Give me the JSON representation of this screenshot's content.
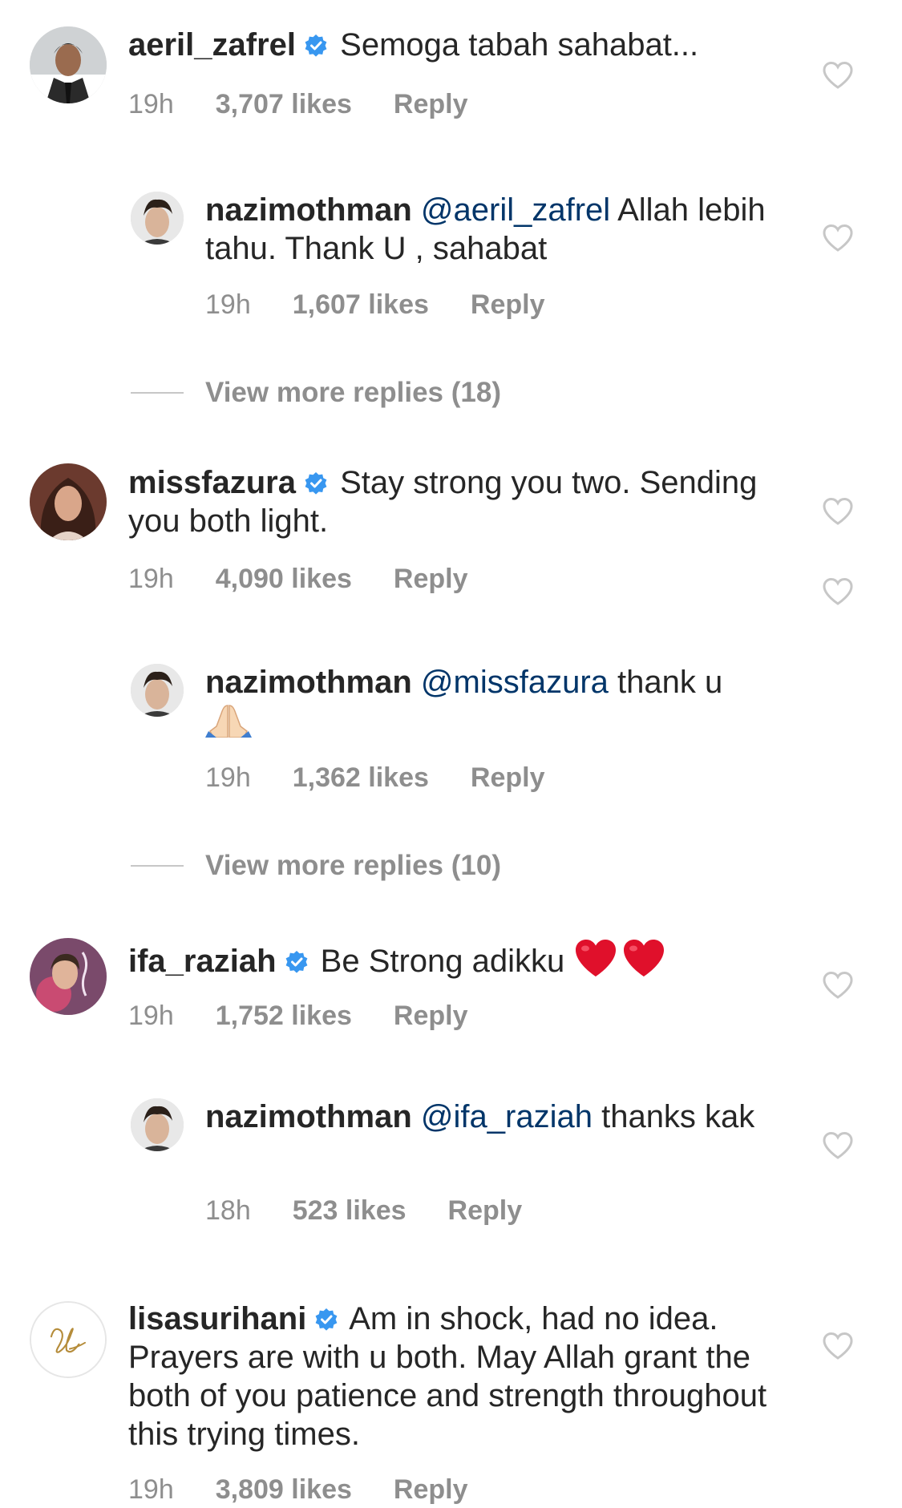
{
  "comments": [
    {
      "username": "aeril_zafrel",
      "verified": true,
      "text": "Semoga tabah sahabat...",
      "time": "19h",
      "likes": "3,707 likes",
      "reply_label": "Reply",
      "reply": {
        "username": "nazimothman",
        "mention": "@aeril_zafrel",
        "text": " Allah lebih tahu. Thank U , sahabat",
        "time": "19h",
        "likes": "1,607 likes",
        "reply_label": "Reply"
      },
      "view_more": "View more replies (18)"
    },
    {
      "username": "missfazura",
      "verified": true,
      "text": "Stay strong you two. Sending you both light.",
      "time": "19h",
      "likes": "4,090 likes",
      "reply_label": "Reply",
      "reply": {
        "username": "nazimothman",
        "mention": "@missfazura",
        "text": " thank u",
        "emoji": "folded-hands",
        "time": "19h",
        "likes": "1,362 likes",
        "reply_label": "Reply"
      },
      "view_more": "View more replies (10)"
    },
    {
      "username": "ifa_raziah",
      "verified": true,
      "text": "Be Strong adikku",
      "emoji": "red-heart-x2",
      "time": "19h",
      "likes": "1,752 likes",
      "reply_label": "Reply",
      "reply": {
        "username": "nazimothman",
        "mention": "@ifa_raziah",
        "text": " thanks kak",
        "time": "18h",
        "likes": "523 likes",
        "reply_label": "Reply"
      }
    },
    {
      "username": "lisasurihani",
      "verified": true,
      "text": "Am in shock, had no idea. Prayers are with u both. May Allah grant the both of you patience and strength throughout this trying times.",
      "time": "19h",
      "likes": "3,809 likes",
      "reply_label": "Reply"
    }
  ],
  "colors": {
    "text": "#262626",
    "meta": "#8e8e8e",
    "mention": "#003569",
    "verified": "#3897f0",
    "heart_outline": "#c7c7c7"
  },
  "icons": {
    "like": "heart-outline-icon",
    "verified": "verified-badge-icon"
  }
}
